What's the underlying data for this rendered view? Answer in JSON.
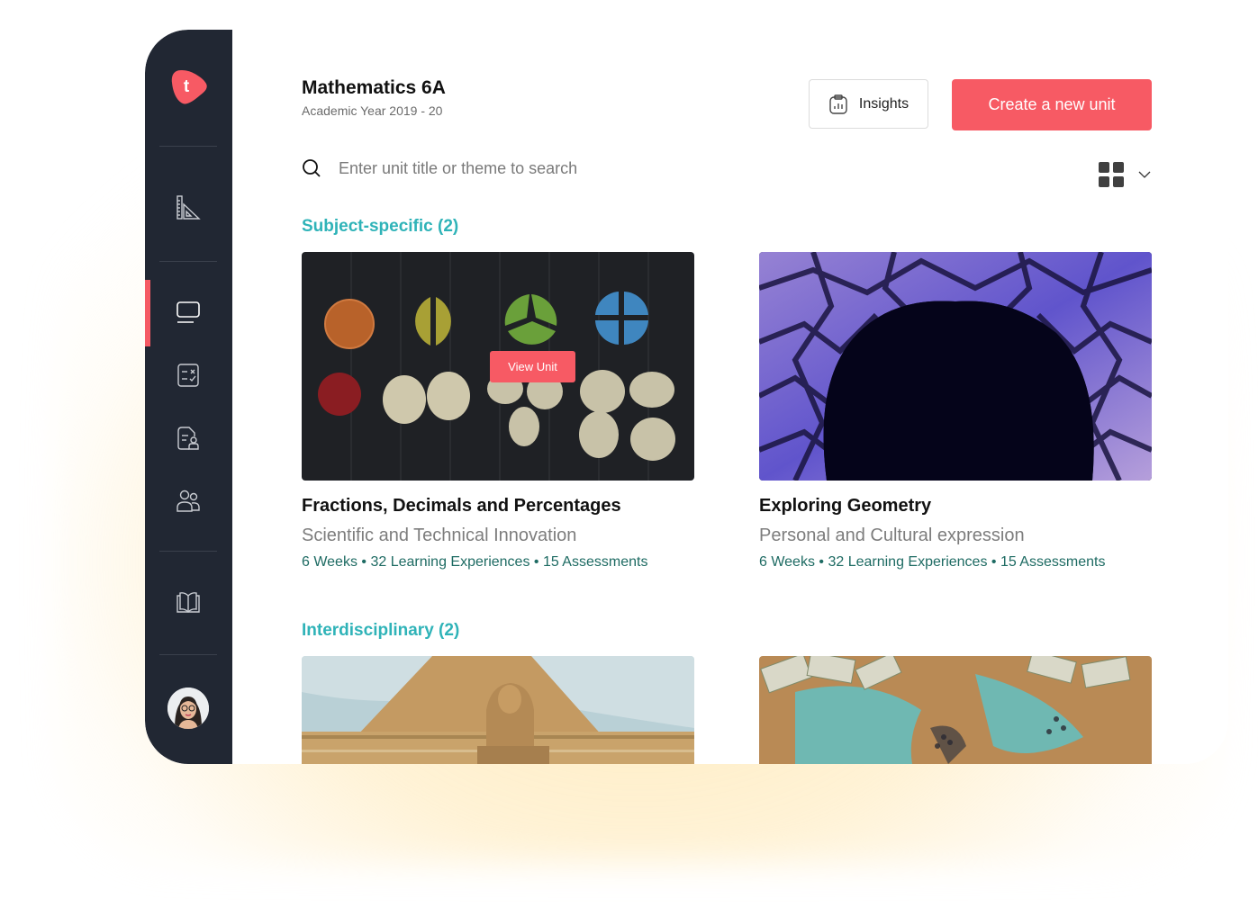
{
  "app": {
    "logo_letter": "t",
    "brand_color": "#f75a64",
    "accent_teal": "#2fb3b8",
    "sidebar_bg": "#212733"
  },
  "sidebar": {
    "items": [
      {
        "icon": "ruler-triangle-icon",
        "active": false
      },
      {
        "icon": "monitor-icon",
        "active": true
      },
      {
        "icon": "checklist-icon",
        "active": false
      },
      {
        "icon": "document-user-icon",
        "active": false
      },
      {
        "icon": "users-icon",
        "active": false
      },
      {
        "icon": "open-book-icon",
        "active": false
      }
    ],
    "avatar": "user-avatar"
  },
  "header": {
    "title": "Mathematics 6A",
    "subtitle": "Academic Year 2019 - 20",
    "insights_label": "Insights",
    "create_label": "Create a new unit"
  },
  "search": {
    "placeholder": "Enter unit title or theme to search",
    "value": ""
  },
  "view": {
    "mode": "grid"
  },
  "sections": [
    {
      "heading": "Subject-specific (2)",
      "cards": [
        {
          "title": "Fractions, Decimals and Percentages",
          "theme": "Scientific and Technical Innovation",
          "meta": "6 Weeks • 32 Learning Experiences • 15 Assessments",
          "image": "fraction-circles-and-apples",
          "hover_button": "View Unit"
        },
        {
          "title": "Exploring Geometry",
          "theme": "Personal and Cultural expression",
          "meta": "6 Weeks • 32 Learning Experiences • 15 Assessments",
          "image": "geometric-light-arch"
        }
      ]
    },
    {
      "heading": "Interdisciplinary (2)",
      "cards": [
        {
          "image": "pyramid-and-sphinx"
        },
        {
          "image": "world-map-with-money-and-pins"
        }
      ]
    }
  ]
}
